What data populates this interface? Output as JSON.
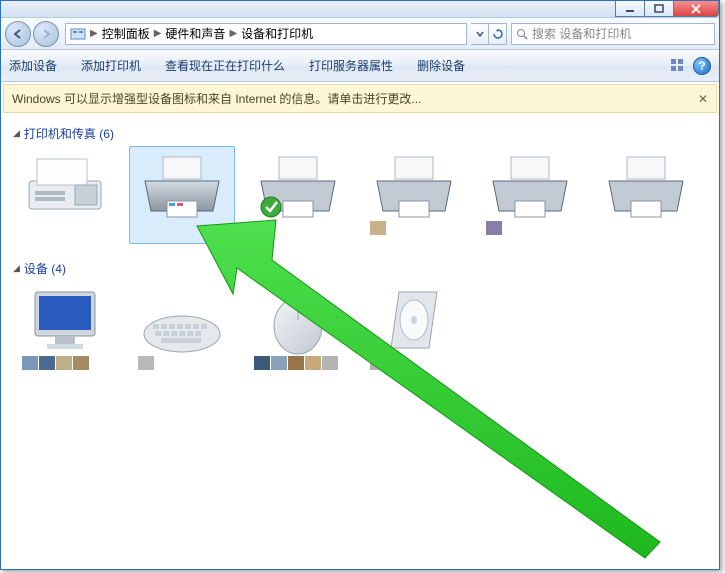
{
  "titlebar": {},
  "breadcrumbs": {
    "root_icon": "control-panel",
    "crumb1": "控制面板",
    "crumb2": "硬件和声音",
    "crumb3": "设备和打印机"
  },
  "search": {
    "placeholder": "搜索 设备和打印机"
  },
  "commands": {
    "add_device": "添加设备",
    "add_printer": "添加打印机",
    "view_printing": "查看现在正在打印什么",
    "server_props": "打印服务器属性",
    "remove_device": "删除设备"
  },
  "infobar": {
    "text": "Windows 可以显示增强型设备图标和来自 Internet 的信息。请单击进行更改..."
  },
  "groups": {
    "printers": {
      "label": "打印机和传真",
      "count": "(6)"
    },
    "devices": {
      "label": "设备",
      "count": "(4)"
    }
  },
  "colors": {
    "arrow": "#33cc33"
  }
}
